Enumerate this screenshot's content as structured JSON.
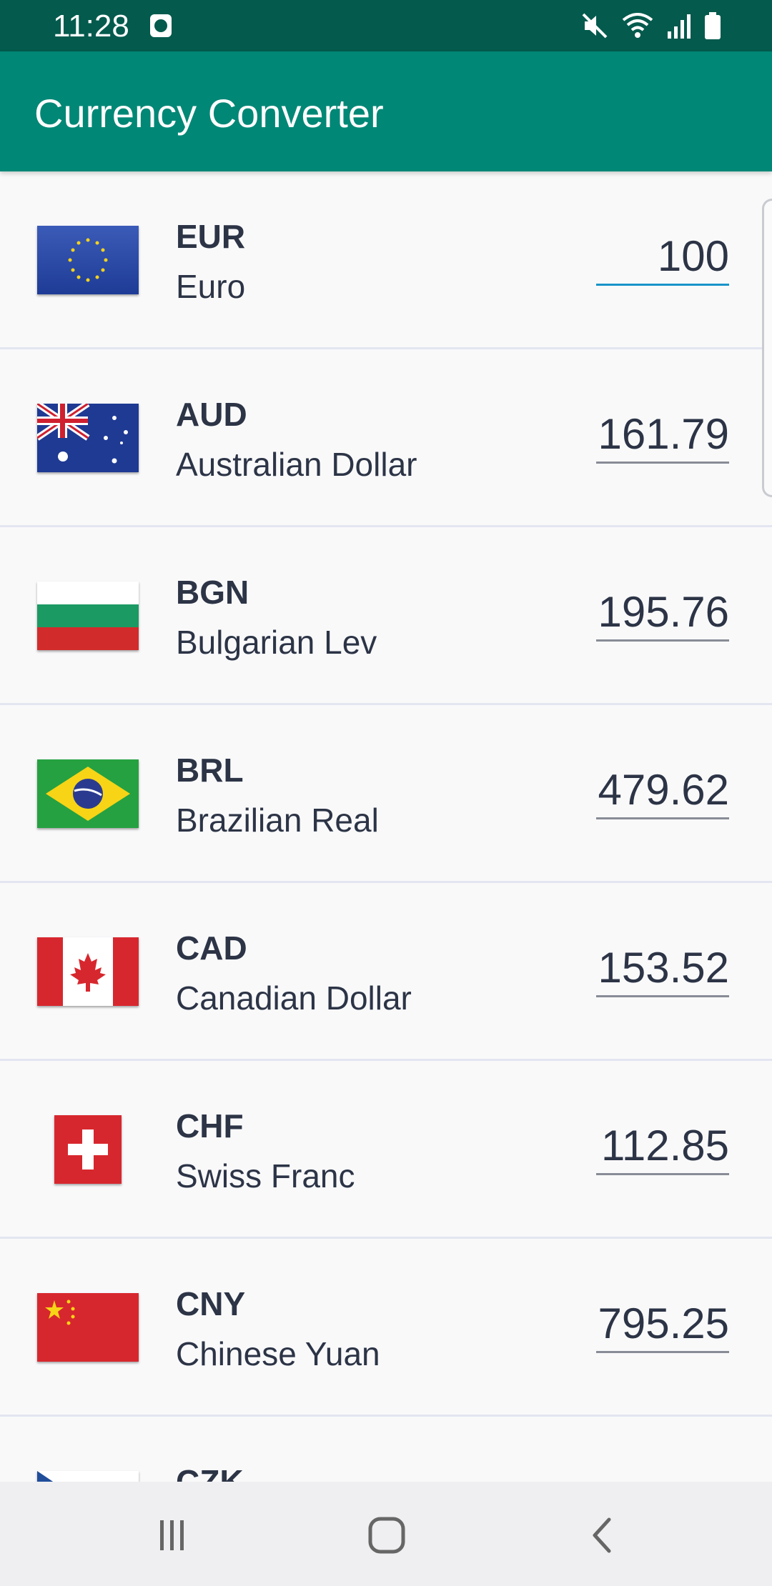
{
  "status_bar": {
    "time": "11:28"
  },
  "app_bar": {
    "title": "Currency Converter"
  },
  "currencies": [
    {
      "code": "EUR",
      "name": "Euro",
      "amount": "100",
      "flag": "eu-flag",
      "active": true
    },
    {
      "code": "AUD",
      "name": "Australian Dollar",
      "amount": "161.79",
      "flag": "au-flag"
    },
    {
      "code": "BGN",
      "name": "Bulgarian Lev",
      "amount": "195.76",
      "flag": "bg-flag"
    },
    {
      "code": "BRL",
      "name": "Brazilian Real",
      "amount": "479.62",
      "flag": "br-flag"
    },
    {
      "code": "CAD",
      "name": "Canadian Dollar",
      "amount": "153.52",
      "flag": "ca-flag"
    },
    {
      "code": "CHF",
      "name": "Swiss Franc",
      "amount": "112.85",
      "flag": "ch-flag"
    },
    {
      "code": "CNY",
      "name": "Chinese Yuan",
      "amount": "795.25",
      "flag": "cn-flag"
    },
    {
      "code": "CZK",
      "name": "",
      "amount": "",
      "flag": "cz-flag"
    }
  ],
  "nav_bar": {
    "icons": [
      "recent-apps-icon",
      "home-icon",
      "back-icon"
    ]
  },
  "colors": {
    "status_bar": "#035a4d",
    "app_bar": "#018776",
    "active_underline": "#1993c8"
  }
}
